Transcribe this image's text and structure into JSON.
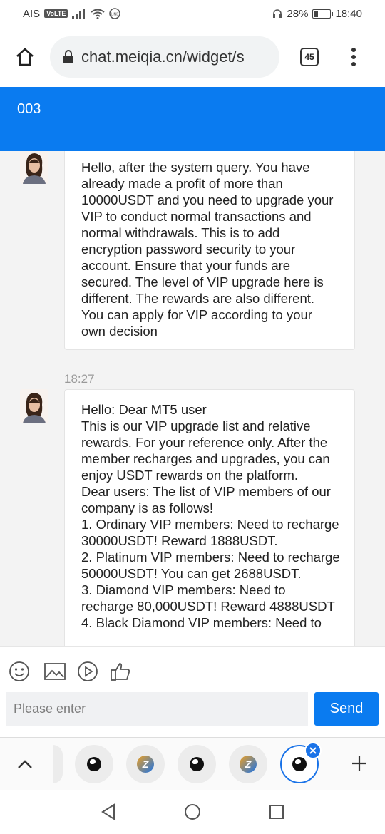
{
  "status_bar": {
    "carrier": "AIS",
    "volte": "VoLTE",
    "battery_percent": "28%",
    "battery_level": 0.28,
    "time": "18:40"
  },
  "browser": {
    "url": "chat.meiqia.cn/widget/s",
    "tab_count": "45"
  },
  "chat": {
    "title": "003",
    "messages": [
      {
        "text": "Hello, after the system query. You have already made a profit of more than 10000USDT and you need to upgrade your VIP to conduct normal transactions and normal withdrawals. This is to add encryption password security to your account. Ensure that your funds are secured. The level of VIP upgrade here is different. The rewards are also different. You can apply for VIP according to your own decision"
      },
      {
        "timestamp": "18:27",
        "text": "Hello: Dear MT5 user\nThis is our VIP upgrade list and relative rewards. For your reference only. After the member recharges and upgrades, you can enjoy USDT rewards on the platform.\nDear users: The list of VIP members of our company is as follows!\n1. Ordinary VIP members: Need to recharge 30000USDT! Reward 1888USDT.\n2. Platinum VIP members: Need to recharge 50000USDT! You can get 2688USDT.\n3. Diamond VIP members: Need to recharge 80,000USDT! Reward 4888USDT\n4. Black Diamond VIP members: Need to"
      }
    ]
  },
  "input": {
    "placeholder": "Please enter",
    "send_label": "Send",
    "tools": [
      "emoji-icon",
      "image-icon",
      "video-icon",
      "thumbs-up-icon"
    ]
  },
  "bubble_bar": {
    "bubbles": [
      "globe-icon",
      "z-app-icon",
      "globe-icon",
      "z-app-icon",
      "globe-icon"
    ]
  }
}
